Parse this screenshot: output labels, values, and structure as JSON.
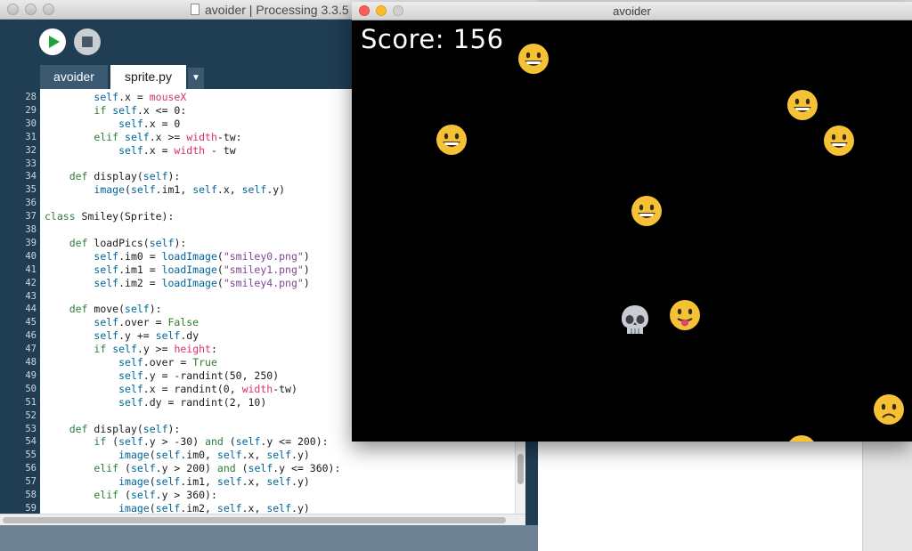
{
  "ide": {
    "window_title": "avoider | Processing 3.3.5",
    "run_label": "Run",
    "stop_label": "Stop",
    "tabs": [
      {
        "label": "avoider",
        "active": false
      },
      {
        "label": "sprite.py",
        "active": true
      }
    ],
    "tab_menu_glyph": "▼",
    "code_lines": [
      {
        "n": "28",
        "html": "        <span class=\"fn\">self</span>.x = <span class=\"sys\">mouseX</span>"
      },
      {
        "n": "29",
        "html": "        <span class=\"kw\">if</span> <span class=\"fn\">self</span>.x &lt;= 0:"
      },
      {
        "n": "30",
        "html": "            <span class=\"fn\">self</span>.x = 0"
      },
      {
        "n": "31",
        "html": "        <span class=\"kw\">elif</span> <span class=\"fn\">self</span>.x &gt;= <span class=\"sys\">width</span>-tw:"
      },
      {
        "n": "32",
        "html": "            <span class=\"fn\">self</span>.x = <span class=\"sys\">width</span> - tw"
      },
      {
        "n": "33",
        "html": ""
      },
      {
        "n": "34",
        "html": "    <span class=\"kw\">def</span> display(<span class=\"fn\">self</span>):"
      },
      {
        "n": "35",
        "html": "        <span class=\"fn\">image</span>(<span class=\"fn\">self</span>.im1, <span class=\"fn\">self</span>.x, <span class=\"fn\">self</span>.y)"
      },
      {
        "n": "36",
        "html": ""
      },
      {
        "n": "37",
        "html": "<span class=\"kw\">class</span> Smiley(Sprite):"
      },
      {
        "n": "38",
        "html": ""
      },
      {
        "n": "39",
        "html": "    <span class=\"kw\">def</span> loadPics(<span class=\"fn\">self</span>):"
      },
      {
        "n": "40",
        "html": "        <span class=\"fn\">self</span>.im0 = <span class=\"fn\">loadImage</span>(<span class=\"str\">\"smiley0.png\"</span>)"
      },
      {
        "n": "41",
        "html": "        <span class=\"fn\">self</span>.im1 = <span class=\"fn\">loadImage</span>(<span class=\"str\">\"smiley1.png\"</span>)"
      },
      {
        "n": "42",
        "html": "        <span class=\"fn\">self</span>.im2 = <span class=\"fn\">loadImage</span>(<span class=\"str\">\"smiley4.png\"</span>)"
      },
      {
        "n": "43",
        "html": ""
      },
      {
        "n": "44",
        "html": "    <span class=\"kw\">def</span> move(<span class=\"fn\">self</span>):"
      },
      {
        "n": "45",
        "html": "        <span class=\"fn\">self</span>.over = <span class=\"const\">False</span>"
      },
      {
        "n": "46",
        "html": "        <span class=\"fn\">self</span>.y += <span class=\"fn\">self</span>.dy"
      },
      {
        "n": "47",
        "html": "        <span class=\"kw\">if</span> <span class=\"fn\">self</span>.y &gt;= <span class=\"sys\">height</span>:"
      },
      {
        "n": "48",
        "html": "            <span class=\"fn\">self</span>.over = <span class=\"const\">True</span>"
      },
      {
        "n": "49",
        "html": "            <span class=\"fn\">self</span>.y = -randint(50, 250)"
      },
      {
        "n": "50",
        "html": "            <span class=\"fn\">self</span>.x = randint(0, <span class=\"sys\">width</span>-tw)"
      },
      {
        "n": "51",
        "html": "            <span class=\"fn\">self</span>.dy = randint(2, 10)"
      },
      {
        "n": "52",
        "html": ""
      },
      {
        "n": "53",
        "html": "    <span class=\"kw\">def</span> display(<span class=\"fn\">self</span>):"
      },
      {
        "n": "54",
        "html": "        <span class=\"kw\">if</span> (<span class=\"fn\">self</span>.y &gt; -30) <span class=\"kw\">and</span> (<span class=\"fn\">self</span>.y &lt;= 200):"
      },
      {
        "n": "55",
        "html": "            <span class=\"fn\">image</span>(<span class=\"fn\">self</span>.im0, <span class=\"fn\">self</span>.x, <span class=\"fn\">self</span>.y)"
      },
      {
        "n": "56",
        "html": "        <span class=\"kw\">elif</span> (<span class=\"fn\">self</span>.y &gt; 200) <span class=\"kw\">and</span> (<span class=\"fn\">self</span>.y &lt;= 360):"
      },
      {
        "n": "57",
        "html": "            <span class=\"fn\">image</span>(<span class=\"fn\">self</span>.im1, <span class=\"fn\">self</span>.x, <span class=\"fn\">self</span>.y)"
      },
      {
        "n": "58",
        "html": "        <span class=\"kw\">elif</span> (<span class=\"fn\">self</span>.y &gt; 360):"
      },
      {
        "n": "59",
        "html": "            <span class=\"fn\">image</span>(<span class=\"fn\">self</span>.im2, <span class=\"fn\">self</span>.x, <span class=\"fn\">self</span>.y)"
      }
    ]
  },
  "sketch": {
    "window_title": "avoider",
    "score_text": "Score: 156",
    "sprites": [
      {
        "kind": "grin"
      },
      {
        "kind": "grin"
      },
      {
        "kind": "grin"
      },
      {
        "kind": "grin"
      },
      {
        "kind": "grin"
      },
      {
        "kind": "skull"
      },
      {
        "kind": "tongue"
      },
      {
        "kind": "frown"
      },
      {
        "kind": "grin"
      }
    ]
  },
  "colors": {
    "ide_bg": "#1f3d53",
    "run_green": "#1aa53a",
    "emoji_yellow": "#f6c235",
    "skull_gray": "#c8ccd0",
    "mac_red": "#fc5f57",
    "mac_yellow": "#fdbc2e",
    "mac_green": "#28c840"
  }
}
